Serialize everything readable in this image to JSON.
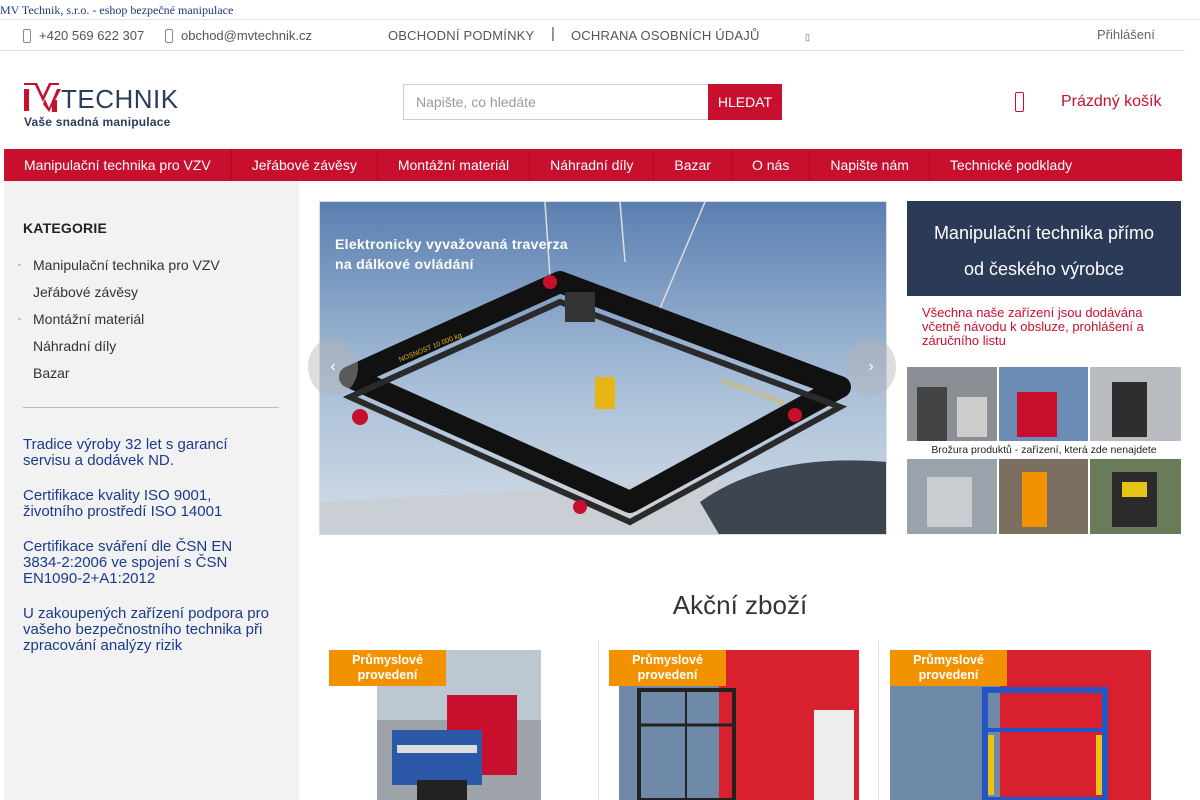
{
  "page": {
    "title": "MV Technik, s.r.o. - eshop bezpečné manipulace"
  },
  "topbar": {
    "phone": "+420 569 622 307",
    "email": "obchod@mvtechnik.cz",
    "links": [
      "OBCHODNÍ PODMÍNKY",
      "OCHRANA OSOBNÍCH ÚDAJŮ"
    ],
    "separator": "|",
    "login": "Přihlášení"
  },
  "header": {
    "logo_text": "MVTECHNIK",
    "logo_tagline": "Vaše snadná manipulace",
    "search_placeholder": "Napište, co hledáte",
    "search_button": "HLEDAT",
    "cart_label": "Prázdný košík"
  },
  "nav": {
    "items": [
      "Manipulační technika pro VZV",
      "Jeřábové závěsy",
      "Montážní materiál",
      "Náhradní díly",
      "Bazar",
      "O nás",
      "Napište nám",
      "Technické podklady"
    ]
  },
  "sidebar": {
    "heading": "KATEGORIE",
    "categories": [
      {
        "label": "Manipulační technika pro VZV",
        "has_children": true
      },
      {
        "label": "Jeřábové závěsy",
        "has_children": false
      },
      {
        "label": "Montážní materiál",
        "has_children": true
      },
      {
        "label": "Náhradní díly",
        "has_children": false
      },
      {
        "label": "Bazar",
        "has_children": false
      }
    ],
    "promos": [
      "Tradice výroby 32 let s garancí servisu a dodávek ND.",
      "Certifikace kvality ISO 9001, životního prostředí ISO 14001",
      "Certifikace sváření dle ČSN EN 3834-2:2006 ve spojení s ČSN EN1090-2+A1:2012",
      "U zakoupených zařízení podpora pro vašeho bezpečnostního technika při zpracování analýzy rizik"
    ]
  },
  "slider": {
    "caption_line1": "Elektronicky vyvažovaná traverza",
    "caption_line2": "na dálkové ovládání",
    "beam_label": "NOSNOST 10 000 kg",
    "prev_icon": "‹",
    "next_icon": "›"
  },
  "info": {
    "box_line1": "Manipulační technika přímo",
    "box_line2": "od českého výrobce",
    "note": "Všechna naše zařízení jsou dodávána včetně návodu k obsluze, prohlášení a záručního listu",
    "brochure_caption": "Brožura produktů - zařízení, která zde nenajdete"
  },
  "sale": {
    "title": "Akční zboží",
    "products": [
      {
        "badge": "Průmyslové provedení"
      },
      {
        "badge": "Průmyslové provedení"
      },
      {
        "badge": "Průmyslové provedení"
      }
    ]
  },
  "colors": {
    "brand_red": "#c8102e",
    "navy": "#2b3a57",
    "link_blue": "#1c3a8c",
    "badge_orange": "#f39200"
  }
}
